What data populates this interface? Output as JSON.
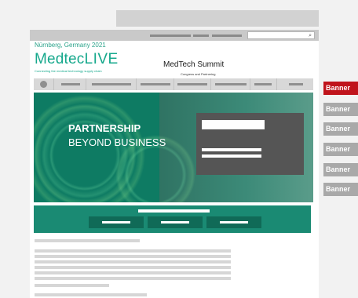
{
  "header": {
    "dateline": "Nürnberg, Germany 2021",
    "logo_main": "Medtec",
    "logo_live": "LIVE",
    "logo_tagline": "Connecting the medical technology supply chain",
    "summit_logo": "MedTech Summit",
    "summit_tagline": "Congress and Partnering"
  },
  "hero": {
    "title_line1": "PARTNERSHIP",
    "title_line2": "BEYOND BUSINESS"
  },
  "banners": [
    {
      "label": "Banner",
      "color": "#c0141c"
    },
    {
      "label": "Banner",
      "color": "#a9a9a9"
    },
    {
      "label": "Banner",
      "color": "#a9a9a9"
    },
    {
      "label": "Banner",
      "color": "#a9a9a9"
    },
    {
      "label": "Banner",
      "color": "#a9a9a9"
    },
    {
      "label": "Banner",
      "color": "#a9a9a9"
    }
  ],
  "colors": {
    "brand_green": "#16a88c",
    "cta_green": "#1a8a73",
    "banner_active": "#c0141c"
  },
  "icons": {
    "search": "search-icon",
    "home": "home-icon"
  }
}
